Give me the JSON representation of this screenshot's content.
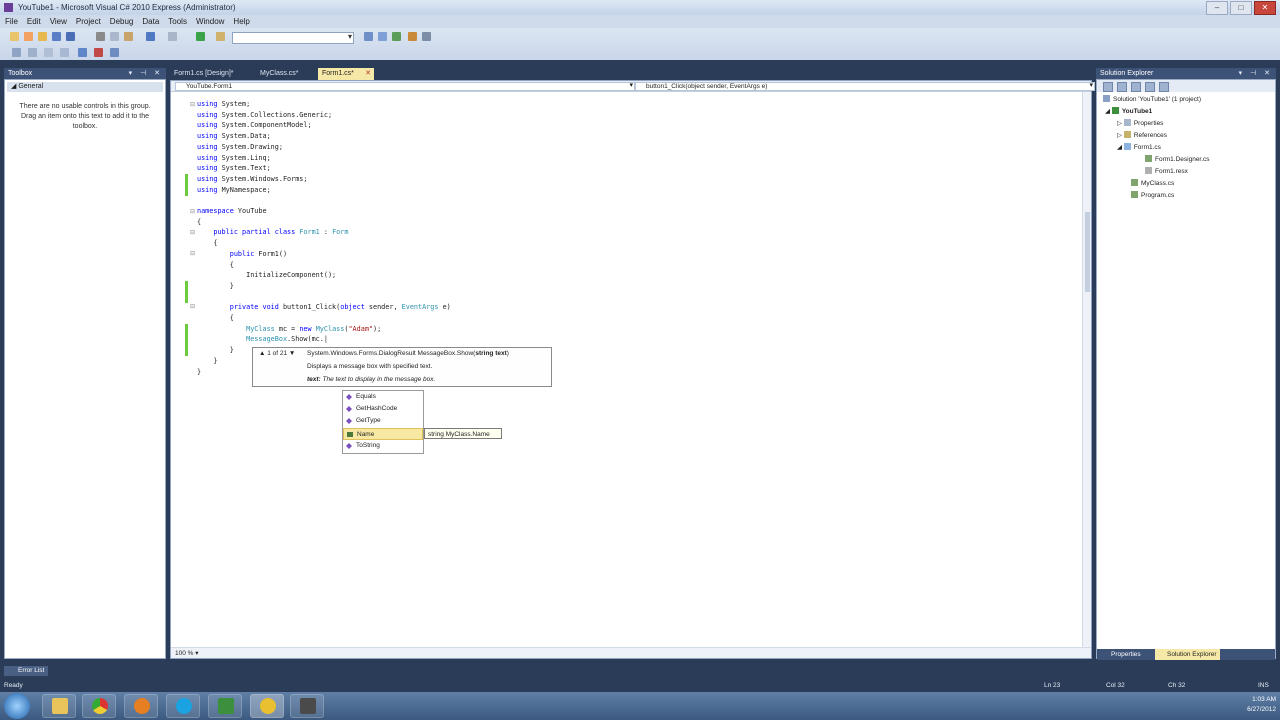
{
  "window": {
    "title": "YouTube1 - Microsoft Visual C# 2010 Express (Administrator)",
    "controls": [
      "–",
      "□",
      "✕"
    ]
  },
  "menu": [
    "File",
    "Edit",
    "View",
    "Project",
    "Debug",
    "Data",
    "Tools",
    "Window",
    "Help"
  ],
  "toolbox": {
    "title": "Toolbox",
    "group": "General",
    "message": "There are no usable controls in this group. Drag an item onto this text to add it to the toolbox."
  },
  "tabs": [
    "Form1.cs [Design]*",
    "MyClass.cs*",
    "Form1.cs*"
  ],
  "editor": {
    "type_dropdown": "YouTube.Form1",
    "member_dropdown": "button1_Click(object sender, EventArgs e)",
    "zoom": "100 %",
    "code_lines": [
      [
        [
          "kw",
          "using"
        ],
        [
          "",
          "System;"
        ]
      ],
      [
        [
          "kw",
          "using"
        ],
        [
          "",
          "System.Collections.Generic;"
        ]
      ],
      [
        [
          "kw",
          "using"
        ],
        [
          "",
          "System.ComponentModel;"
        ]
      ],
      [
        [
          "kw",
          "using"
        ],
        [
          "",
          "System.Data;"
        ]
      ],
      [
        [
          "kw",
          "using"
        ],
        [
          "",
          "System.Drawing;"
        ]
      ],
      [
        [
          "kw",
          "using"
        ],
        [
          "",
          "System.Linq;"
        ]
      ],
      [
        [
          "kw",
          "using"
        ],
        [
          "",
          "System.Text;"
        ]
      ],
      [
        [
          "kw",
          "using"
        ],
        [
          "",
          "System.Windows.Forms;"
        ]
      ],
      [
        [
          "kw",
          "using"
        ],
        [
          "",
          "MyNamespace;"
        ]
      ],
      [],
      [
        [
          "kw",
          "namespace"
        ],
        [
          "",
          "YouTube"
        ]
      ],
      [
        [
          "",
          "{"
        ]
      ],
      [
        [
          "",
          "    "
        ],
        [
          "kw",
          "public partial class"
        ],
        [
          "ty",
          "Form1"
        ],
        [
          "",
          ":"
        ],
        [
          "ty",
          "Form"
        ]
      ],
      [
        [
          "",
          "    {"
        ]
      ],
      [
        [
          "",
          "        "
        ],
        [
          "kw",
          "public"
        ],
        [
          "",
          "Form1()"
        ]
      ],
      [
        [
          "",
          "        {"
        ]
      ],
      [
        [
          "",
          "            InitializeComponent();"
        ]
      ],
      [
        [
          "",
          "        }"
        ]
      ],
      [],
      [
        [
          "",
          "        "
        ],
        [
          "kw",
          "private void"
        ],
        [
          "",
          "button1_Click("
        ],
        [
          "kw",
          "object"
        ],
        [
          "",
          "sender,"
        ],
        [
          "ty",
          "EventArgs"
        ],
        [
          "",
          "e)"
        ]
      ],
      [
        [
          "",
          "        {"
        ]
      ],
      [
        [
          "",
          "            "
        ],
        [
          "ty",
          "MyClass"
        ],
        [
          "",
          "mc ="
        ],
        [
          "kw",
          "new"
        ],
        [
          "ty",
          "MyClass"
        ],
        [
          "",
          "("
        ],
        [
          "st",
          "\"Adam\""
        ],
        [
          "",
          ");"
        ]
      ],
      [
        [
          "",
          "            "
        ],
        [
          "ty",
          "MessageBox"
        ],
        [
          "",
          ".Show(mc.|"
        ]
      ],
      [
        [
          "",
          "        }"
        ]
      ],
      [
        [
          "",
          "    }"
        ]
      ],
      [
        [
          "",
          "}"
        ]
      ]
    ]
  },
  "tooltip": {
    "counter": "▲ 1 of 21 ▼",
    "signature_prefix": "System.Windows.Forms.DialogResult MessageBox.Show(",
    "signature_param": "string text",
    "signature_suffix": ")",
    "description": "Displays a message box with specified text.",
    "param_name": "text:",
    "param_desc": "The text to display in the message box."
  },
  "completion": {
    "items": [
      "Equals",
      "GetHashCode",
      "GetType",
      "Name",
      "ToString"
    ],
    "selected_index": 3,
    "quickinfo": "string MyClass.Name"
  },
  "solution_explorer": {
    "title": "Solution Explorer",
    "nodes": [
      {
        "label": "Solution 'YouTube1' (1 project)",
        "level": 0
      },
      {
        "label": "YouTube1",
        "level": 1
      },
      {
        "label": "Properties",
        "level": 2
      },
      {
        "label": "References",
        "level": 2
      },
      {
        "label": "Form1.cs",
        "level": 2
      },
      {
        "label": "Form1.Designer.cs",
        "level": 3
      },
      {
        "label": "Form1.resx",
        "level": 3
      },
      {
        "label": "MyClass.cs",
        "level": 2
      },
      {
        "label": "Program.cs",
        "level": 2
      }
    ],
    "tabs": [
      "Properties",
      "Solution Explorer"
    ]
  },
  "bottom": {
    "error_list": "Error List",
    "status": "Ready",
    "ln": "Ln 23",
    "col": "Col 32",
    "ch": "Ch 32",
    "ins": "INS"
  },
  "tray": {
    "time": "1:03 AM",
    "date": "6/27/2012"
  },
  "colors": {
    "keyword": "#0000ff",
    "type": "#2b91af",
    "string": "#a31515",
    "chrome": "#2b3c59"
  }
}
